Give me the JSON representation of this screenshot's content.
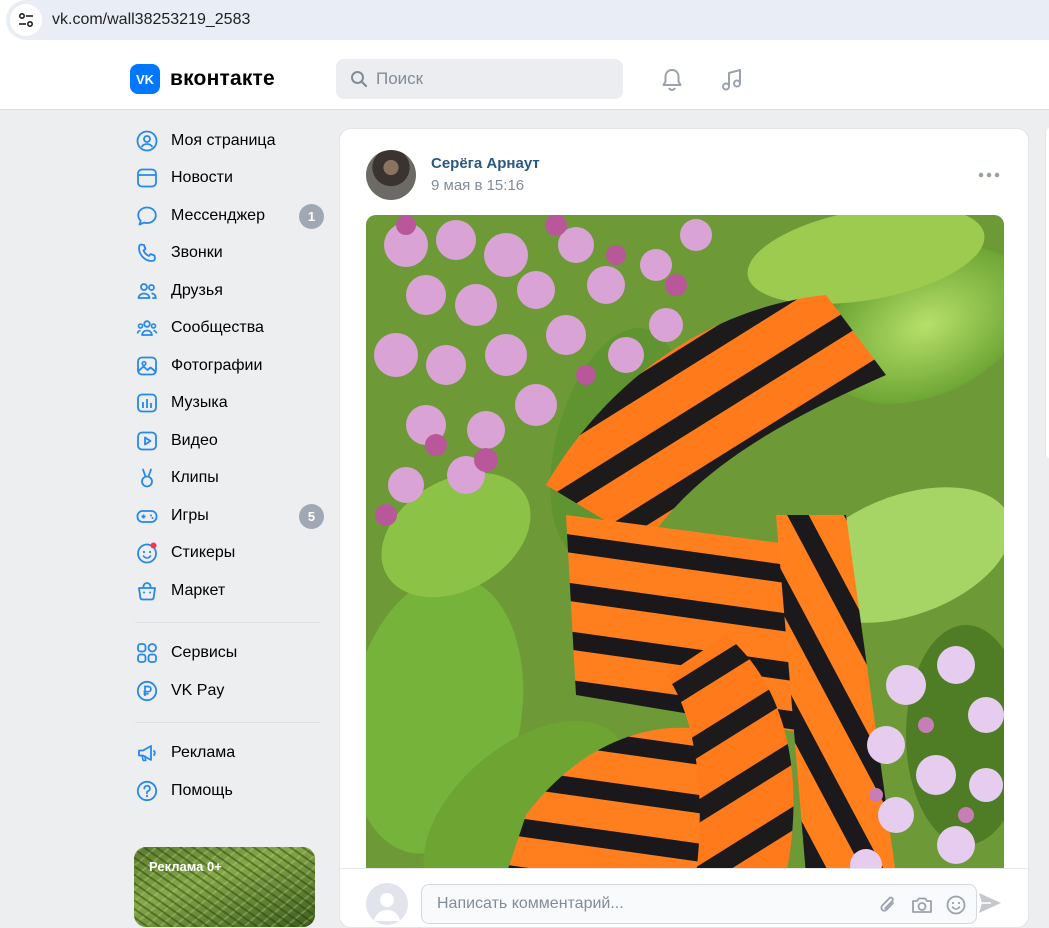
{
  "browser": {
    "url": "vk.com/wall38253219_2583"
  },
  "header": {
    "logo_text": "вконтакте",
    "logo_mark": "VK",
    "search_placeholder": "Поиск"
  },
  "nav": {
    "items": [
      {
        "label": "Моя страница",
        "icon": "user-circle-icon"
      },
      {
        "label": "Новости",
        "icon": "news-icon"
      },
      {
        "label": "Мессенджер",
        "icon": "message-icon",
        "badge": "1"
      },
      {
        "label": "Звонки",
        "icon": "phone-icon"
      },
      {
        "label": "Друзья",
        "icon": "friends-icon"
      },
      {
        "label": "Сообщества",
        "icon": "communities-icon"
      },
      {
        "label": "Фотографии",
        "icon": "photo-icon"
      },
      {
        "label": "Музыка",
        "icon": "music-icon"
      },
      {
        "label": "Видео",
        "icon": "video-icon"
      },
      {
        "label": "Клипы",
        "icon": "clips-icon"
      },
      {
        "label": "Игры",
        "icon": "gamepad-icon",
        "badge": "5"
      },
      {
        "label": "Стикеры",
        "icon": "sticker-icon"
      },
      {
        "label": "Маркет",
        "icon": "market-icon"
      }
    ],
    "secondary": [
      {
        "label": "Сервисы",
        "icon": "services-icon"
      },
      {
        "label": "VK Pay",
        "icon": "vkpay-icon"
      }
    ],
    "tertiary": [
      {
        "label": "Реклама",
        "icon": "megaphone-icon"
      },
      {
        "label": "Помощь",
        "icon": "help-icon"
      }
    ],
    "ad_label": "Реклама 0+"
  },
  "post": {
    "author": "Серёга Арнаут",
    "date": "9 мая в 15:16",
    "comment_placeholder": "Написать комментарий..."
  },
  "colors": {
    "accent": "#0077ff",
    "link": "#2a5885",
    "muted": "#818c99",
    "icon": "#2688eb",
    "background": "#edeef0"
  }
}
